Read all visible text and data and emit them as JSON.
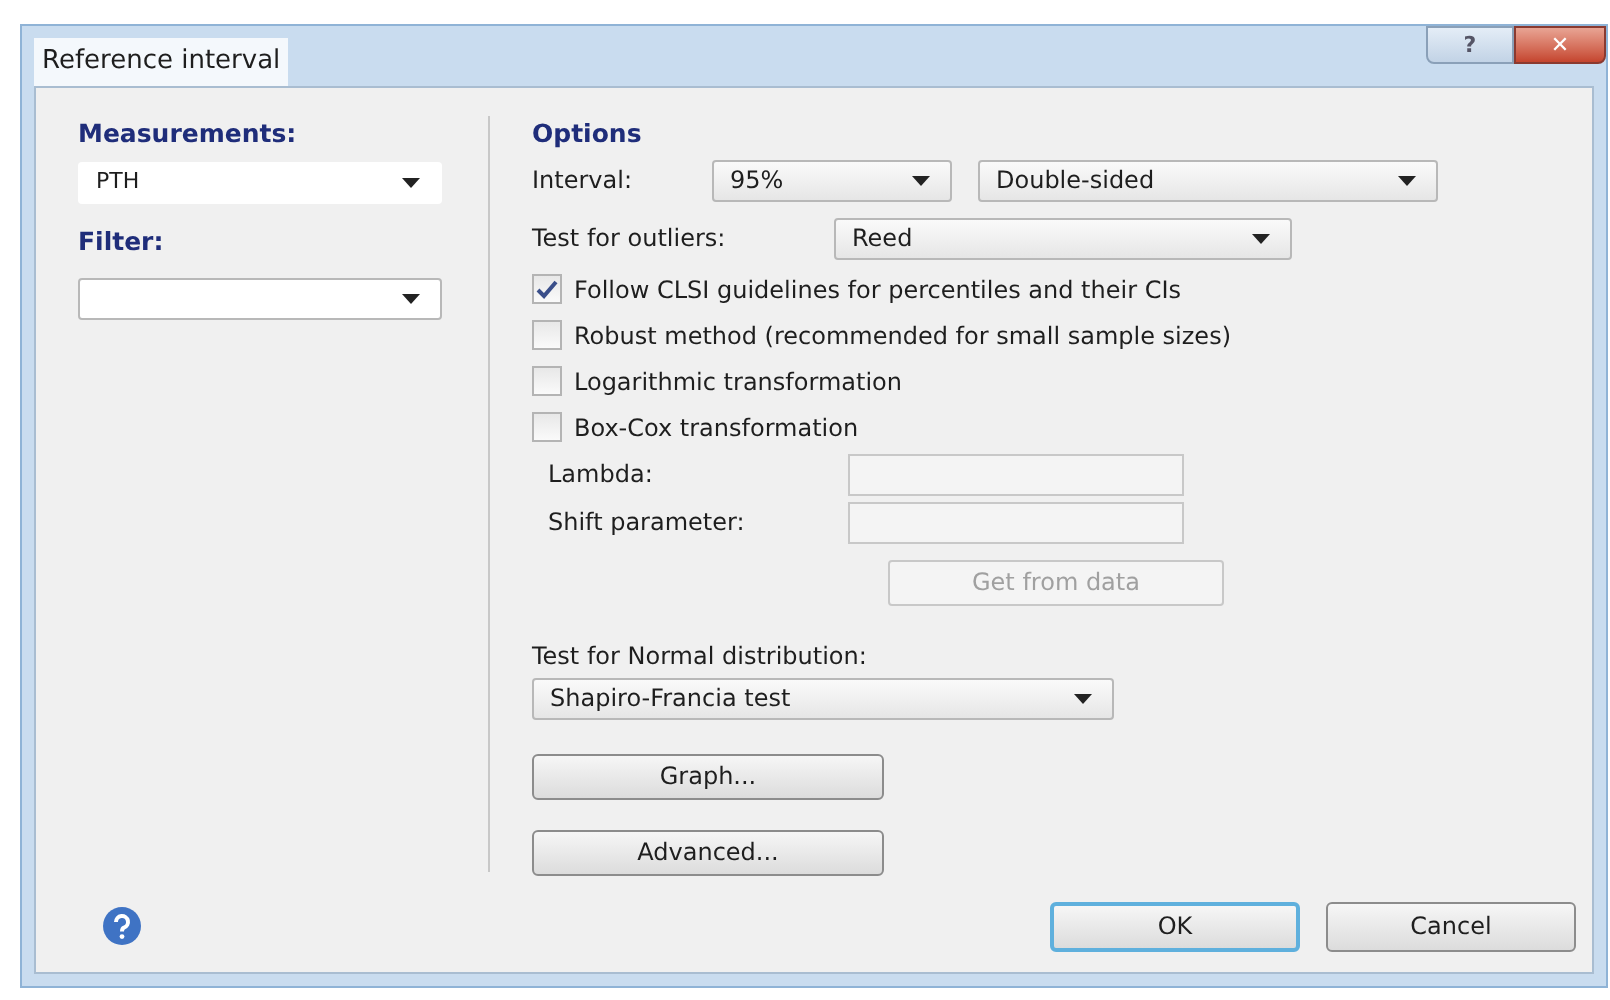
{
  "window": {
    "title": "Reference interval",
    "help_button": "?",
    "close_button": "✕"
  },
  "measurements": {
    "label": "Measurements:",
    "value": "PTH"
  },
  "filter": {
    "label": "Filter:"
  },
  "options": {
    "heading": "Options",
    "interval": {
      "label": "Interval:",
      "level_value": "95%",
      "sides_value": "Double-sided"
    },
    "outliers": {
      "label": "Test for outliers:",
      "value": "Reed"
    },
    "checkboxes": [
      {
        "label": "Follow CLSI guidelines for percentiles and their CIs",
        "checked": true
      },
      {
        "label": "Robust method (recommended for small sample sizes)",
        "checked": false
      },
      {
        "label": "Logarithmic transformation",
        "checked": false
      },
      {
        "label": "Box-Cox transformation",
        "checked": false
      }
    ],
    "fields": [
      {
        "label": "Lambda:"
      },
      {
        "label": "Shift parameter:"
      }
    ],
    "get_from_data": {
      "label": "Get from data",
      "disabled": true
    },
    "normal_test": {
      "label": "Test for Normal distribution:",
      "value": "Shapiro-Francia test"
    },
    "buttons": [
      {
        "label": "Graph..."
      },
      {
        "label": "Advanced..."
      }
    ]
  },
  "footer": {
    "buttons": [
      {
        "label": "OK",
        "default": true
      },
      {
        "label": "Cancel",
        "default": false
      }
    ]
  }
}
